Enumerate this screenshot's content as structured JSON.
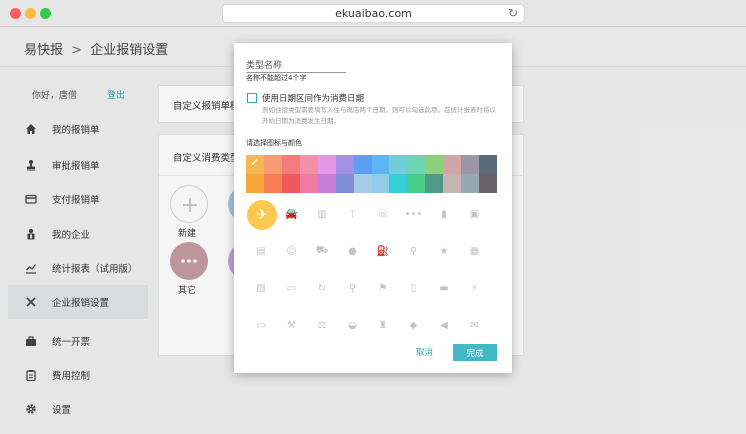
{
  "browser": {
    "url": "ekuaibao.com",
    "reload_icon": "reload-icon"
  },
  "header": {
    "brand": "易快报",
    "separator": ">",
    "title": "企业报销设置"
  },
  "sidebar": {
    "greeting": "你好，唐僧",
    "logout": "登出",
    "items": [
      {
        "label": "我的报销单",
        "icon": "home-icon"
      },
      {
        "label": "审批报销单",
        "icon": "stamp-icon"
      },
      {
        "label": "支付报销单",
        "icon": "card-icon"
      },
      {
        "label": "我的企业",
        "icon": "building-icon"
      },
      {
        "label": "统计报表（试用版）",
        "icon": "chart-icon"
      },
      {
        "label": "企业报销设置",
        "icon": "tools-icon",
        "active": true
      },
      {
        "label": "统一开票",
        "icon": "briefcase-icon"
      },
      {
        "label": "费用控制",
        "icon": "clipboard-icon"
      },
      {
        "label": "设置",
        "icon": "gear-icon"
      }
    ]
  },
  "cards": {
    "template_title": "自定义报销单模板",
    "types_title": "自定义消费类型",
    "new_label": "新建",
    "other_label": "其它"
  },
  "modal": {
    "name_placeholder": "类型名称",
    "name_hint": "名称不能超过4个字",
    "checkbox_label": "使用日期区间作为消费日期",
    "checkbox_desc": "例如住宿类型需要填写入住与离店两个日期，则可以勾选此项。在统计报表时将以开始日期为消费发生日期。",
    "palette_title": "请选择图标与颜色",
    "colors_row1": [
      "#f6b651",
      "#f79b74",
      "#f37b7b",
      "#f38fa6",
      "#e399e6",
      "#a68fe6",
      "#5c9ef2",
      "#5cb6f3",
      "#71cdd9",
      "#6ed4b3",
      "#8ccf7c",
      "#d1a4a7",
      "#9d96a6",
      "#5c6b7a"
    ],
    "colors_row2": [
      "#f4a93a",
      "#f87d52",
      "#f0595b",
      "#ef7aa2",
      "#c57fd6",
      "#7f8fd7",
      "#a9cce6",
      "#93cbe9",
      "#35d0d5",
      "#49cc8b",
      "#4e9a84",
      "#c5b3b6",
      "#97a9b0",
      "#6b6168"
    ],
    "selected_color": "#f6b651",
    "icons": [
      "plane-icon",
      "car-icon",
      "building-icon",
      "dining-icon",
      "phone-icon",
      "more-icon",
      "bookmark-icon",
      "inbox-icon",
      "book-icon",
      "group-icon",
      "cart-icon",
      "apple-icon",
      "gas-pump-icon",
      "pin-icon",
      "star-icon",
      "train-icon",
      "gift-icon",
      "printer-icon",
      "refresh-icon",
      "search-icon",
      "flag-icon",
      "document-icon",
      "briefcase-icon",
      "bolt-icon",
      "bus-icon",
      "wrench-icon",
      "scale-icon",
      "cake-icon",
      "bottle-icon",
      "graduation-cap-icon",
      "megaphone-icon",
      "mail-icon"
    ],
    "selected_icon": "plane-icon",
    "cancel_label": "取消",
    "confirm_label": "完成"
  }
}
